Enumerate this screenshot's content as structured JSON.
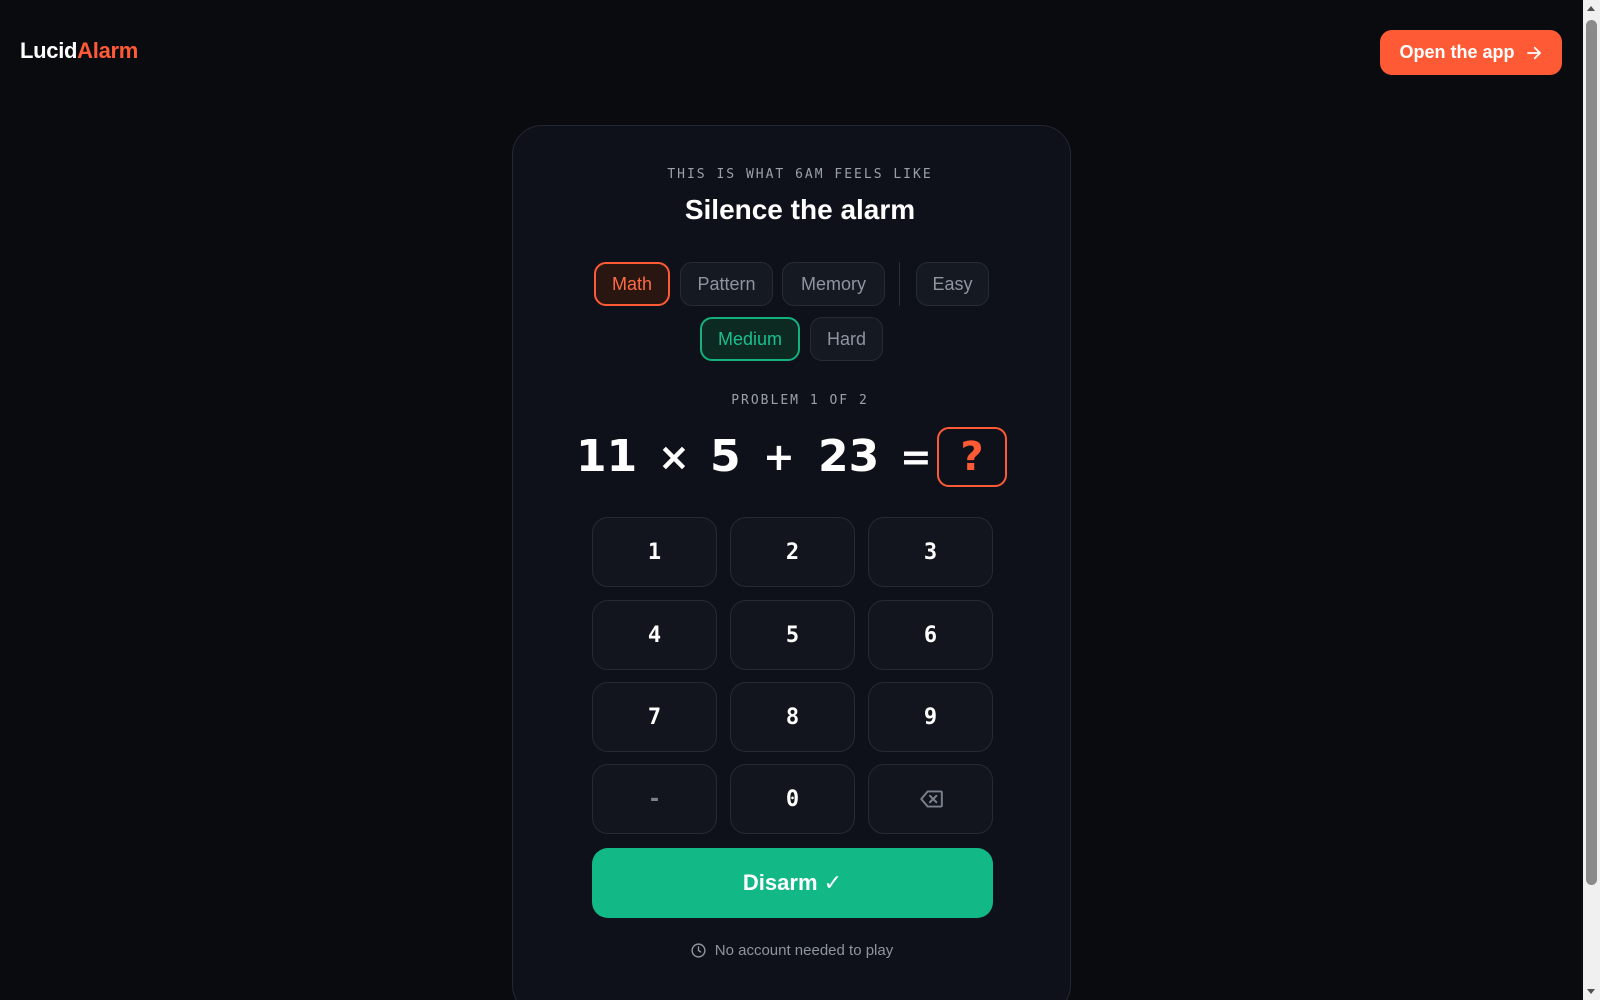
{
  "header": {
    "logo_part_a": "Lucid",
    "logo_part_b": "Alarm",
    "open_app_label": "Open the app",
    "open_app_icon": "arrow-right-icon"
  },
  "card": {
    "eyebrow": "THIS IS WHAT 6AM FEELS LIKE",
    "title": "Silence the alarm",
    "modes": [
      {
        "label": "Math",
        "selected": true
      },
      {
        "label": "Pattern",
        "selected": false
      },
      {
        "label": "Memory",
        "selected": false
      }
    ],
    "difficulties": [
      {
        "label": "Easy",
        "selected": false
      },
      {
        "label": "Medium",
        "selected": true
      },
      {
        "label": "Hard",
        "selected": false
      }
    ],
    "problem_label": "PROBLEM 1 OF 2",
    "equation": {
      "a": "11",
      "op1": "×",
      "b": "5",
      "op2": "+",
      "c": "23",
      "eq": "=",
      "answer_placeholder": "?"
    },
    "keypad": [
      "1",
      "2",
      "3",
      "4",
      "5",
      "6",
      "7",
      "8",
      "9",
      "-",
      "0"
    ],
    "backspace_icon": "backspace-icon",
    "disarm_label": "Disarm ✓",
    "footnote": "No account needed to play",
    "footnote_icon": "clock-icon"
  },
  "colors": {
    "accent_orange": "#ff5a36",
    "accent_green": "#12b886",
    "background": "#0a0b0f",
    "card": "#0e1119"
  }
}
